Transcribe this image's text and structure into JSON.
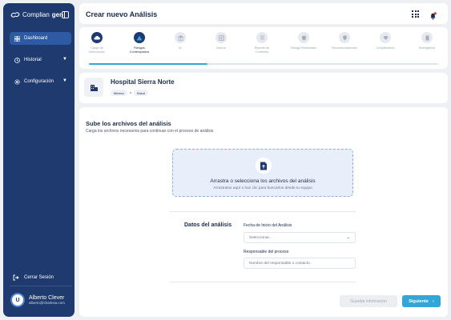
{
  "sidebar": {
    "logo_light": "Complian",
    "logo_bold": "gen",
    "items": [
      {
        "label": "Dashboard",
        "icon": "grid-icon"
      },
      {
        "label": "Historial",
        "icon": "history-icon"
      },
      {
        "label": "Configuración",
        "icon": "gear-icon"
      }
    ],
    "logout_label": "Cerrar Sesión",
    "user": {
      "initial": "U",
      "name": "Alberto Clever",
      "email": "alberto@sharksia.com"
    }
  },
  "header": {
    "title": "Crear nuevo Análisis"
  },
  "steps": [
    {
      "label": "Carga de información",
      "state": "done"
    },
    {
      "label": "Riesgos Contemplados",
      "state": "current"
    },
    {
      "label": "IA",
      "state": "pending"
    },
    {
      "label": "Norma",
      "state": "pending"
    },
    {
      "label": "Reporte de Controles",
      "state": "pending"
    },
    {
      "label": "Riesgo Residuales",
      "state": "pending"
    },
    {
      "label": "Recomendaciones",
      "state": "pending"
    },
    {
      "label": "Cumplimiento",
      "state": "pending"
    },
    {
      "label": "Entregables",
      "state": "pending"
    }
  ],
  "progress": 0.34,
  "hospital": {
    "name": "Hospital Sierra Norte",
    "tags": [
      "México",
      "Salud"
    ]
  },
  "upload": {
    "heading": "Sube los archivos del análisis",
    "subtext": "Carga los archivos necesarios para continuar con el proceso de análisis",
    "drop_title": "Arrastra o selecciona los archivos del análisis",
    "drop_sub": "Arrastralos aquí o haz clic para buscarlos desde tu equipo"
  },
  "form": {
    "section_label": "Datos del análisis",
    "date_label": "Fecha de Inicio del Análisis",
    "date_value": "Seleccionar...",
    "resp_label": "Responsable del proceso",
    "resp_placeholder": "Nombre del responsable o contacto"
  },
  "actions": {
    "save_label": "Guardar información",
    "next_label": "Siguiente"
  },
  "colors": {
    "sidebar": "#1e3a6e",
    "accent": "#33a6d8",
    "notification": "#e53935"
  }
}
